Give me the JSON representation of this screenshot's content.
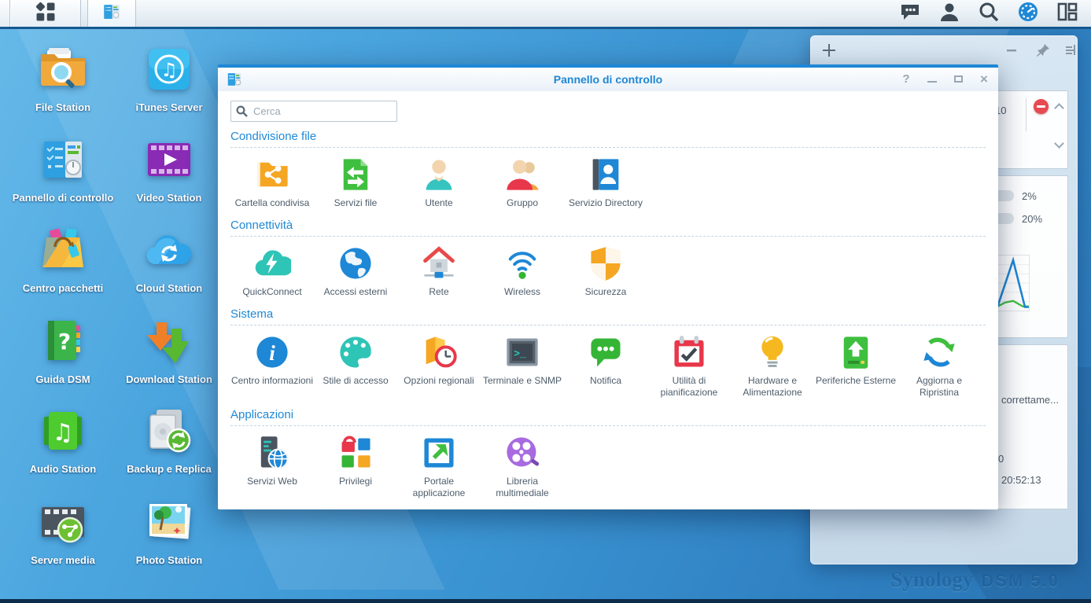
{
  "taskbar": {
    "left_icons": [
      "main-menu-icon",
      "control-panel-task-icon"
    ],
    "right_icons": [
      "chat-icon",
      "user-icon",
      "search-icon",
      "pilot-icon",
      "widgets-icon"
    ]
  },
  "desktop": {
    "icons": [
      {
        "label": "File Station",
        "icon": "file-station-icon"
      },
      {
        "label": "iTunes Server",
        "icon": "itunes-server-icon"
      },
      {
        "label": "Pannello di controllo",
        "icon": "control-panel-icon"
      },
      {
        "label": "Video Station",
        "icon": "video-station-icon"
      },
      {
        "label": "Centro pacchetti",
        "icon": "package-center-icon"
      },
      {
        "label": "Cloud Station",
        "icon": "cloud-station-icon"
      },
      {
        "label": "Guida DSM",
        "icon": "dsm-help-icon"
      },
      {
        "label": "Download Station",
        "icon": "download-station-icon"
      },
      {
        "label": "Audio Station",
        "icon": "audio-station-icon"
      },
      {
        "label": "Backup e Replica",
        "icon": "backup-replication-icon"
      },
      {
        "label": "Server media",
        "icon": "media-server-icon"
      },
      {
        "label": "Photo Station",
        "icon": "photo-station-icon"
      }
    ]
  },
  "window": {
    "title": "Pannello di controllo",
    "titlebar_icon": "control-panel-icon",
    "controls": {
      "help": "?",
      "close": "×"
    },
    "search": {
      "placeholder": "Cerca"
    },
    "sections": [
      {
        "title": "Condivisione file",
        "items": [
          {
            "label": "Cartella condivisa",
            "icon": "shared-folder-icon"
          },
          {
            "label": "Servizi file",
            "icon": "file-services-icon"
          },
          {
            "label": "Utente",
            "icon": "user-icon"
          },
          {
            "label": "Gruppo",
            "icon": "group-icon"
          },
          {
            "label": "Servizio Directory",
            "icon": "directory-service-icon"
          }
        ]
      },
      {
        "title": "Connettività",
        "items": [
          {
            "label": "QuickConnect",
            "icon": "quickconnect-icon"
          },
          {
            "label": "Accessi esterni",
            "icon": "external-access-icon"
          },
          {
            "label": "Rete",
            "icon": "network-icon"
          },
          {
            "label": "Wireless",
            "icon": "wireless-icon"
          },
          {
            "label": "Sicurezza",
            "icon": "security-icon"
          }
        ]
      },
      {
        "title": "Sistema",
        "items": [
          {
            "label": "Centro informazioni",
            "icon": "info-center-icon"
          },
          {
            "label": "Stile di accesso",
            "icon": "login-style-icon"
          },
          {
            "label": "Opzioni regionali",
            "icon": "regional-options-icon"
          },
          {
            "label": "Terminale e SNMP",
            "icon": "terminal-snmp-icon"
          },
          {
            "label": "Notifica",
            "icon": "notification-icon"
          },
          {
            "label": "Utilità di pianificazione",
            "icon": "task-scheduler-icon"
          },
          {
            "label": "Hardware e Alimentazione",
            "icon": "hardware-power-icon"
          },
          {
            "label": "Periferiche Esterne",
            "icon": "external-devices-icon"
          },
          {
            "label": "Aggiorna e Ripristina",
            "icon": "update-restore-icon"
          }
        ]
      },
      {
        "title": "Applicazioni",
        "items": [
          {
            "label": "Servizi Web",
            "icon": "web-services-icon"
          },
          {
            "label": "Privilegi",
            "icon": "privileges-icon"
          },
          {
            "label": "Portale applicazione",
            "icon": "application-portal-icon"
          },
          {
            "label": "Libreria multimediale",
            "icon": "media-library-icon"
          }
        ]
      }
    ]
  },
  "widget_panel": {
    "header_icons": [
      "add-widget-icon",
      "minimize-panel-icon",
      "pin-icon",
      "panel-layout-icon"
    ],
    "log_widget": {
      "visible_value": "10",
      "icons": [
        "blocked-icon",
        "chevron-up-icon",
        "chevron-down-icon"
      ]
    },
    "monitor_widget": {
      "bars": [
        {
          "value": "2%"
        },
        {
          "value": "20%"
        }
      ],
      "chart": {
        "type": "line",
        "grid": true,
        "series": [
          {
            "name": "blue",
            "color": "#1e87d6",
            "points": [
              [
                0,
                4
              ],
              [
                84,
                4
              ],
              [
                92,
                97
              ],
              [
                98,
                4
              ],
              [
                100,
                4
              ]
            ]
          },
          {
            "name": "green",
            "color": "#3fbf3f",
            "points": [
              [
                0,
                5
              ],
              [
                84,
                5
              ],
              [
                88,
                13
              ],
              [
                92,
                16
              ],
              [
                97,
                5
              ],
              [
                100,
                5
              ]
            ]
          }
        ]
      }
    },
    "health_widget": {
      "visible_lines": [
        "correttame...",
        "0",
        "20:52:13"
      ]
    }
  },
  "watermark": {
    "brand": "Synology",
    "version": "DSM 5.0"
  }
}
